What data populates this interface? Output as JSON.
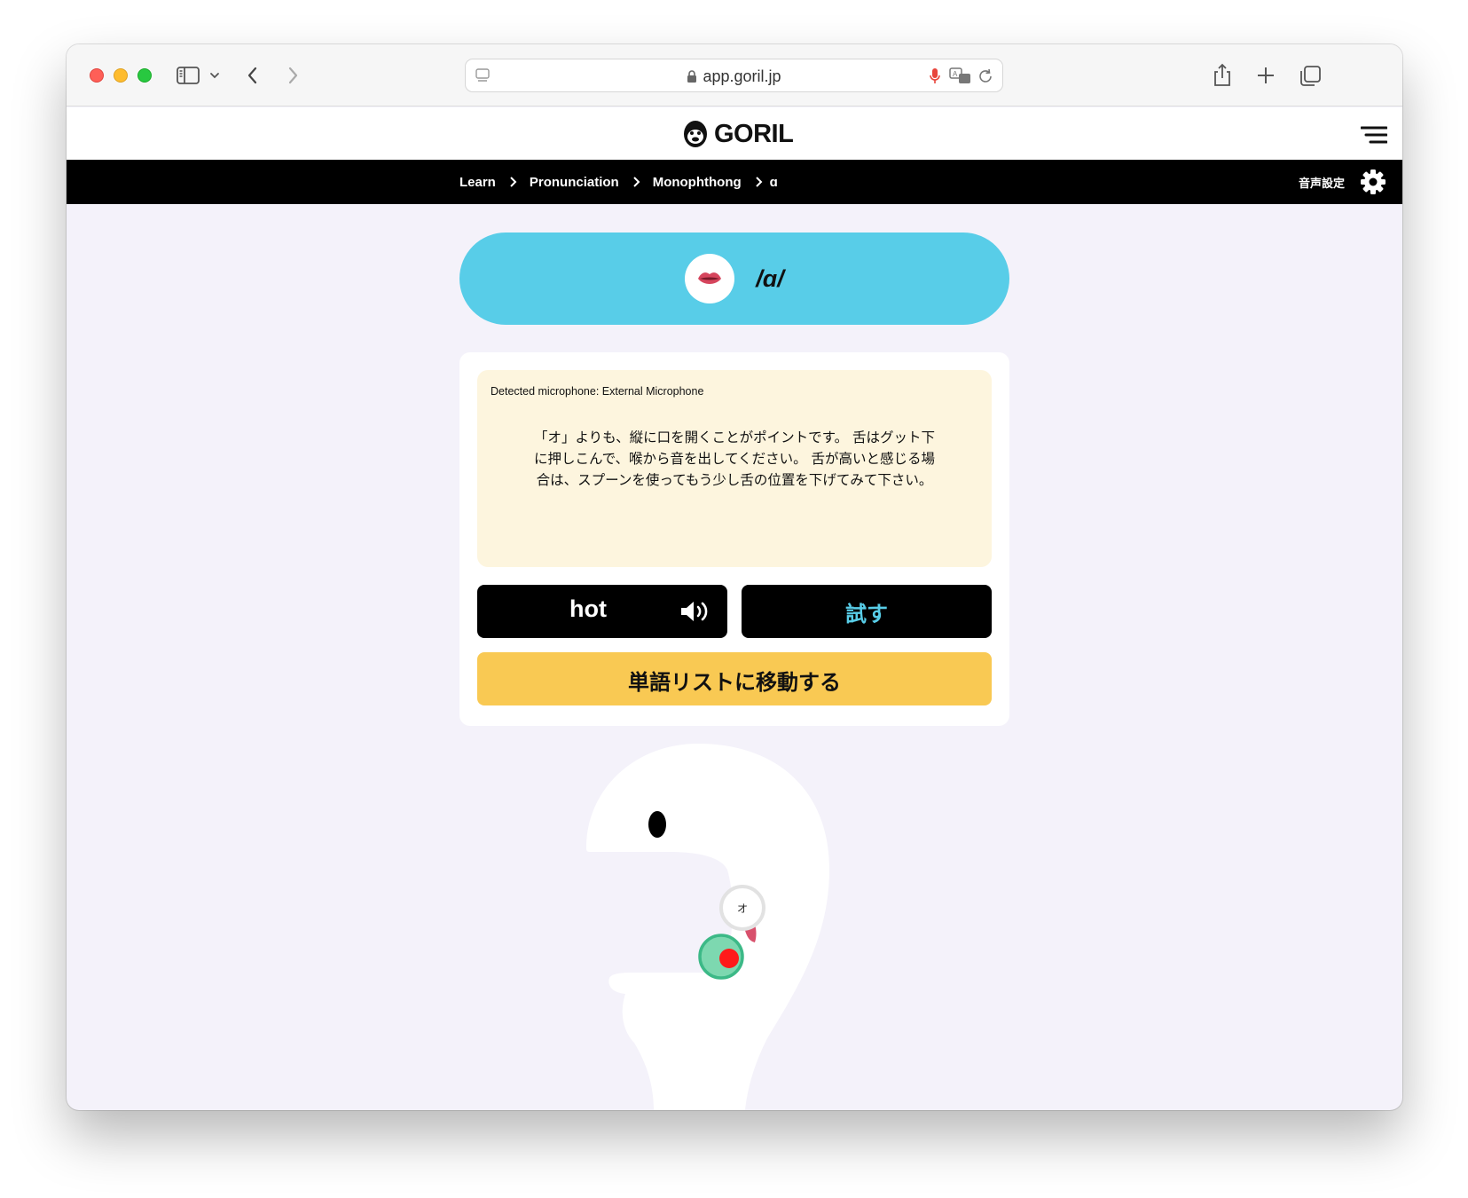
{
  "browser": {
    "url": "app.goril.jp"
  },
  "header": {
    "logo_text": "GORIL"
  },
  "breadcrumb": {
    "items": [
      "Learn",
      "Pronunciation",
      "Monophthong",
      "ɑ"
    ],
    "voice_settings_label": "音声設定"
  },
  "phoneme": {
    "symbol": "/ɑ/"
  },
  "tip": {
    "microphone": "Detected microphone: External Microphone",
    "text": "「オ」よりも、縦に口を開くことがポイントです。 舌はグット下に押しこんで、喉から音を出してください。 舌が高いと感じる場合は、スプーンを使ってもう少し舌の位置を下げてみて下さい。"
  },
  "buttons": {
    "word": "hot",
    "try": "試す",
    "word_list": "単語リストに移動する"
  },
  "diagram": {
    "reference_label": "オ",
    "colors": {
      "reference_ring": "#e2e2e2",
      "target_fill": "#7dd8b0",
      "target_ring": "#3cb987",
      "current_dot": "#ff1a1a",
      "tongue": "#d8506c"
    }
  },
  "colors": {
    "accent_blue": "#58cde8",
    "accent_yellow": "#f9c953",
    "background": "#f4f2fa"
  }
}
